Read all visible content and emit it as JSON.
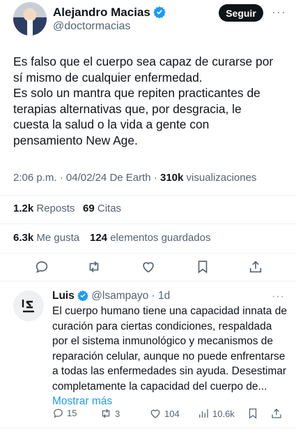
{
  "author": {
    "name": "Alejandro Macias",
    "handle": "@doctormacias",
    "follow_label": "Seguir",
    "more": "···"
  },
  "tweet": {
    "text": "Es falso que el cuerpo sea capaz de curarse por\nsí mismo de cualquier enfermedad.\nEs solo un mantra que repiten practicantes de\nterapias alternativas que, por desgracia,  le\ncuesta la salud o la vida a gente con\npensamiento New Age.",
    "time": "2:06 p.m.",
    "date": "04/02/24",
    "source": "De Earth",
    "views_count": "310k",
    "views_label": "visualizaciones"
  },
  "stats": {
    "reposts_count": "1.2k",
    "reposts_label": "Reposts",
    "quotes_count": "69",
    "quotes_label": "Citas",
    "likes_count": "6.3k",
    "likes_label": "Me gusta",
    "bookmarks_count": "124",
    "bookmarks_label": "elementos guardados"
  },
  "reply": {
    "name": "Luis",
    "handle": "@lsampayo",
    "age": "1d",
    "more": "···",
    "text": "El cuerpo humano tiene una capacidad innata de curación para ciertas condiciones, respaldada por el sistema inmunológico y mecanismos de reparación celular, aunque no puede enfrentarse a todas las enfermedades sin ayuda. Desestimar completamente la capacidad del cuerpo de...",
    "show_more": "Mostrar más",
    "replies": "15",
    "reposts": "3",
    "likes": "104",
    "views": "10.6k"
  },
  "colors": {
    "accent": "#1d9bf0",
    "text": "#0f1419",
    "muted": "#536471"
  }
}
